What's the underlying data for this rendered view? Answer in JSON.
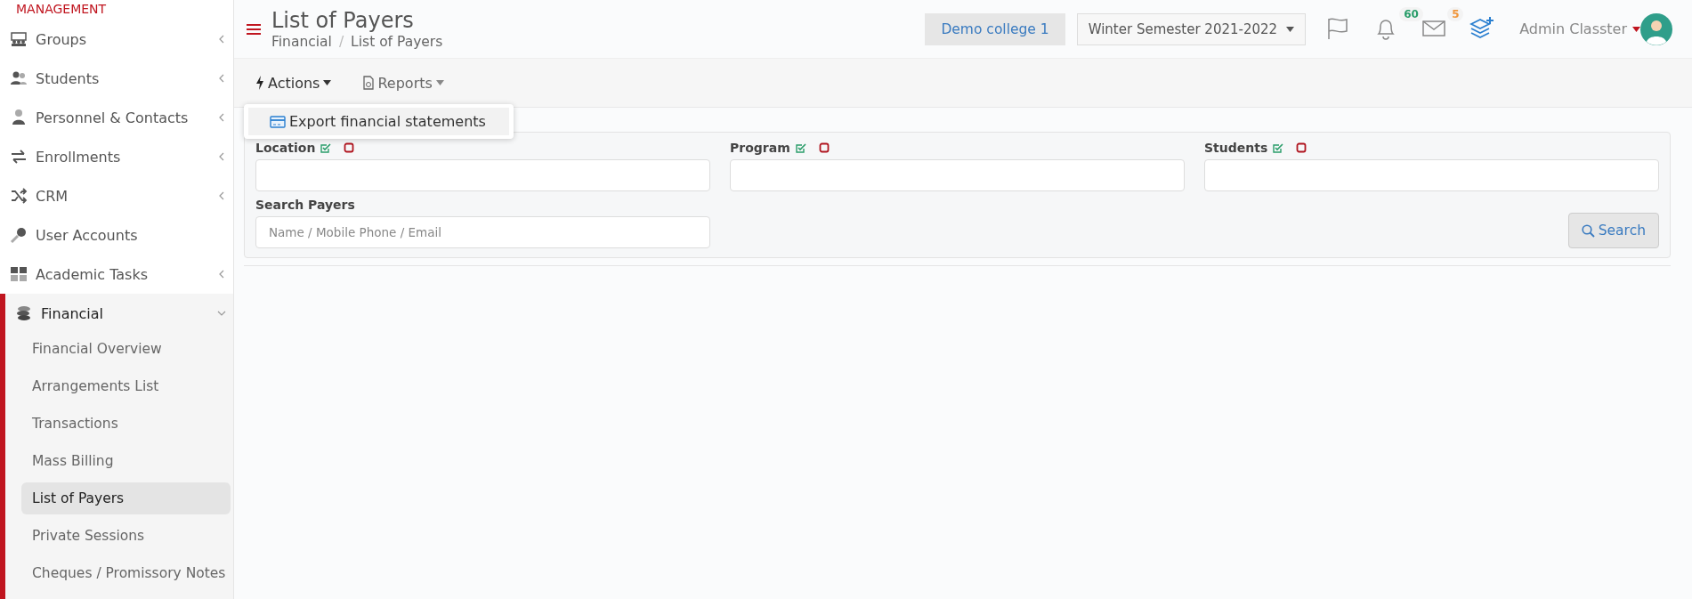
{
  "sidebar": {
    "section_title": "MANAGEMENT",
    "items": [
      {
        "label": "Groups",
        "expanded": false
      },
      {
        "label": "Students",
        "expanded": false
      },
      {
        "label": "Personnel & Contacts",
        "expanded": false
      },
      {
        "label": "Enrollments",
        "expanded": false
      },
      {
        "label": "CRM",
        "expanded": false
      },
      {
        "label": "User Accounts"
      },
      {
        "label": "Academic Tasks",
        "expanded": false
      },
      {
        "label": "Financial",
        "expanded": true,
        "children": [
          {
            "label": "Financial Overview",
            "selected": false
          },
          {
            "label": "Arrangements List",
            "selected": false
          },
          {
            "label": "Transactions",
            "selected": false
          },
          {
            "label": "Mass Billing",
            "selected": false
          },
          {
            "label": "List of Payers",
            "selected": true
          },
          {
            "label": "Private Sessions",
            "selected": false
          },
          {
            "label": "Cheques / Promissory Notes",
            "selected": false
          }
        ]
      }
    ]
  },
  "header": {
    "title": "List of Payers",
    "breadcrumb": [
      "Financial",
      "List of Payers"
    ],
    "breadcrumb_separator": "/",
    "college": "Demo college 1",
    "semester": "Winter Semester 2021-2022",
    "notifications_count": "60",
    "messages_count": "5",
    "user": "Admin Classter"
  },
  "toolbar": {
    "buttons": [
      {
        "label": "Actions",
        "open": true
      },
      {
        "label": "Reports",
        "open": false
      }
    ],
    "menu": [
      {
        "label": "Export financial statements"
      }
    ]
  },
  "filters": {
    "fields": [
      {
        "label": "Location"
      },
      {
        "label": "Program"
      },
      {
        "label": "Students"
      }
    ],
    "search_label": "Search Payers",
    "search_placeholder": "Name / Mobile Phone / Email",
    "search_button": "Search"
  }
}
